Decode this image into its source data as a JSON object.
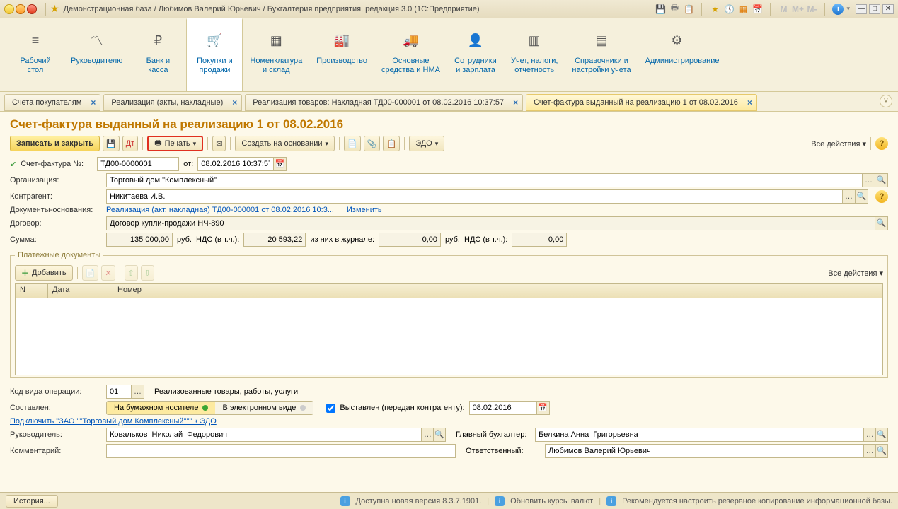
{
  "window": {
    "title": "Демонстрационная база / Любимов Валерий Юрьевич / Бухгалтерия предприятия, редакция 3.0  (1С:Предприятие)",
    "memlabels": {
      "m": "M",
      "mplus": "M+",
      "mminus": "M-"
    }
  },
  "sections": [
    {
      "id": "desktop",
      "label": "Рабочий\nстол"
    },
    {
      "id": "manager",
      "label": "Руководителю"
    },
    {
      "id": "bank",
      "label": "Банк и\nкасса"
    },
    {
      "id": "purchase",
      "label": "Покупки и\nпродажи"
    },
    {
      "id": "nomenclature",
      "label": "Номенклатура\nи склад"
    },
    {
      "id": "production",
      "label": "Производство"
    },
    {
      "id": "fixed",
      "label": "Основные\nсредства и НМА"
    },
    {
      "id": "staff",
      "label": "Сотрудники\nи зарплата"
    },
    {
      "id": "tax",
      "label": "Учет, налоги,\nотчетность"
    },
    {
      "id": "ref",
      "label": "Справочники и\nнастройки учета"
    },
    {
      "id": "admin",
      "label": "Администрирование"
    }
  ],
  "tabs": [
    {
      "label": "Счета покупателям"
    },
    {
      "label": "Реализация (акты, накладные)"
    },
    {
      "label": "Реализация товаров: Накладная ТД00-000001 от 08.02.2016 10:37:57"
    },
    {
      "label": "Счет-фактура выданный на реализацию 1 от 08.02.2016"
    }
  ],
  "doc": {
    "title": "Счет-фактура выданный на реализацию 1 от 08.02.2016",
    "toolbar": {
      "write_close": "Записать и закрыть",
      "print": "Печать",
      "create_based": "Создать на основании",
      "edo": "ЭДО",
      "all_actions": "Все действия"
    },
    "fields": {
      "schet_label": "Счет-фактура №:",
      "schet_no": "ТД00-0000001",
      "from_label": "от:",
      "date": "08.02.2016 10:37:57",
      "org_label": "Организация:",
      "org": "Торговый дом \"Комплексный\"",
      "contragent_label": "Контрагент:",
      "contragent": "Никитаева И.В.",
      "docbase_label": "Документы-основания:",
      "docbase_link": "Реализация (акт, накладная) ТД00-000001 от 08.02.2016 10:3...",
      "docbase_change": "Изменить",
      "contract_label": "Договор:",
      "contract": "Договор купли-продажи НЧ-890",
      "sum_label": "Сумма:",
      "sum": "135 000,00",
      "rub": "руб.",
      "vat_label": "НДС (в т.ч.):",
      "vat": "20 593,22",
      "journal_label": "из них в журнале:",
      "journal_sum": "0,00",
      "journal_vat": "0,00"
    },
    "payment": {
      "legend": "Платежные документы",
      "add": "Добавить",
      "all_actions": "Все действия",
      "columns": {
        "n": "N",
        "date": "Дата",
        "number": "Номер"
      }
    },
    "footer": {
      "opcode_label": "Код вида операции:",
      "opcode": "01",
      "opcode_desc": "Реализованные товары, работы, услуги",
      "composed_label": "Составлен:",
      "opt_paper": "На бумажном носителе",
      "opt_electronic": "В электронном виде",
      "handed_label": "Выставлен (передан контрагенту):",
      "handed_date": "08.02.2016",
      "connect_link": "Подключить \"ЗАО \"\"Торговый дом Комплексный\"\"\" к ЭДО",
      "manager_label": "Руководитель:",
      "manager": "Ковальков  Николай  Федорович",
      "accountant_label": "Главный бухгалтер:",
      "accountant": "Белкина Анна  Григорьевна",
      "comment_label": "Комментарий:",
      "comment": "",
      "responsible_label": "Ответственный:",
      "responsible": "Любимов Валерий Юрьевич"
    }
  },
  "status": {
    "history": "История...",
    "update": "Доступна новая версия 8.3.7.1901.",
    "rates": "Обновить курсы валют",
    "backup": "Рекомендуется настроить резервное копирование информационной базы."
  }
}
